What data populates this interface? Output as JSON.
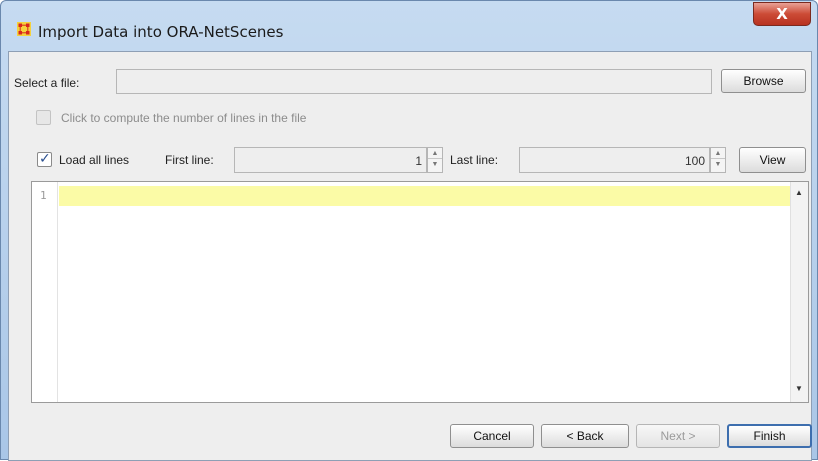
{
  "window": {
    "title": "Import Data into ORA-NetScenes",
    "close_label": "X"
  },
  "file": {
    "label": "Select a file:",
    "value": "",
    "browse_label": "Browse"
  },
  "compute_lines": {
    "label": "Click to compute the number of lines in the file",
    "checked": false,
    "enabled": false
  },
  "lines": {
    "load_all_label": "Load all lines",
    "load_all_checked": true,
    "first_line_label": "First line:",
    "first_line_value": "1",
    "last_line_label": "Last line:",
    "last_line_value": "100",
    "view_label": "View"
  },
  "editor": {
    "line_numbers": [
      "1"
    ],
    "content": ""
  },
  "footer": {
    "cancel_label": "Cancel",
    "back_label": "< Back",
    "next_label": "Next >",
    "finish_label": "Finish"
  },
  "colors": {
    "highlight_line": "#fbfba6",
    "title_bar": "#b9d1ec",
    "close_button": "#cc4b36"
  }
}
